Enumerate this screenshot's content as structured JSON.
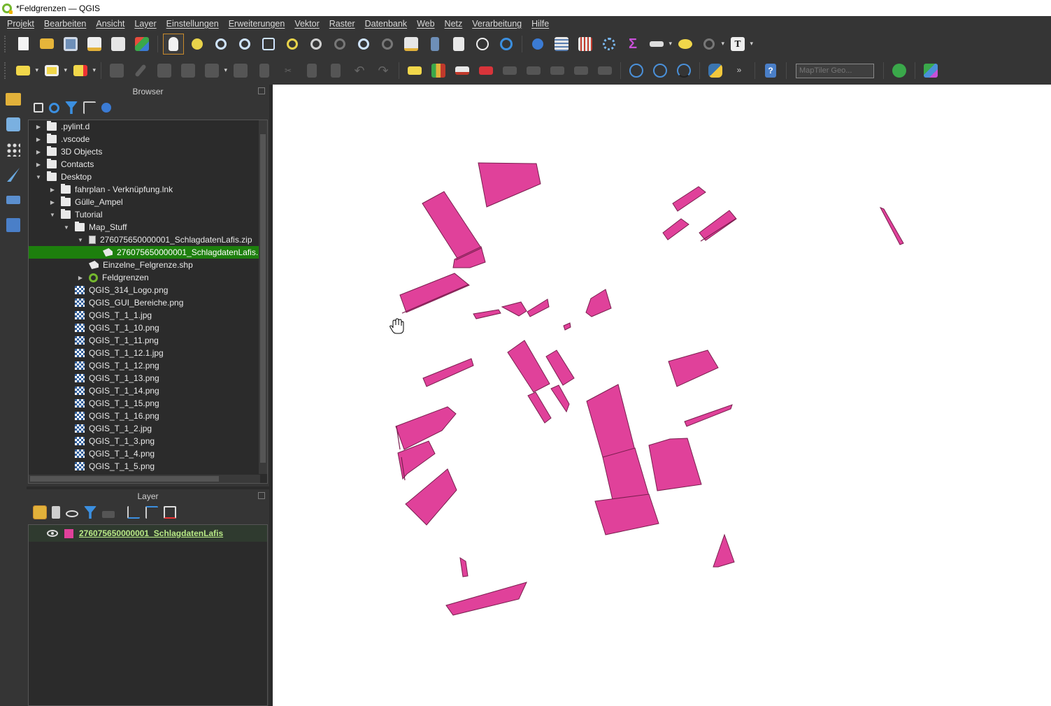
{
  "window": {
    "title": "*Feldgrenzen — QGIS"
  },
  "menubar": {
    "items": [
      "Projekt",
      "Bearbeiten",
      "Ansicht",
      "Layer",
      "Einstellungen",
      "Erweiterungen",
      "Vektor",
      "Raster",
      "Datenbank",
      "Web",
      "Netz",
      "Verarbeitung",
      "Hilfe"
    ]
  },
  "toolbar2": {
    "geocoder_placeholder": "MapTiler Geo..."
  },
  "browser": {
    "title": "Browser",
    "tree": [
      {
        "label": ".pylint.d",
        "type": "folder",
        "level": 1,
        "state": "collapsed"
      },
      {
        "label": ".vscode",
        "type": "folder",
        "level": 1,
        "state": "collapsed"
      },
      {
        "label": "3D Objects",
        "type": "folder",
        "level": 1,
        "state": "collapsed"
      },
      {
        "label": "Contacts",
        "type": "folder",
        "level": 1,
        "state": "collapsed"
      },
      {
        "label": "Desktop",
        "type": "folder",
        "level": 1,
        "state": "expanded"
      },
      {
        "label": "fahrplan - Verknüpfung.lnk",
        "type": "link",
        "level": 2,
        "state": "collapsed"
      },
      {
        "label": "Gülle_Ampel",
        "type": "folder",
        "level": 2,
        "state": "collapsed"
      },
      {
        "label": "Tutorial",
        "type": "folder",
        "level": 2,
        "state": "expanded"
      },
      {
        "label": "Map_Stuff",
        "type": "folder",
        "level": 3,
        "state": "expanded"
      },
      {
        "label": "276075650000001_SchlagdatenLafis.zip",
        "type": "zip",
        "level": 4,
        "state": "expanded"
      },
      {
        "label": "276075650000001_SchlagdatenLafis.",
        "type": "poly",
        "level": 5,
        "state": "leaf",
        "selected": true
      },
      {
        "label": "Einzelne_Felgrenze.shp",
        "type": "poly",
        "level": 4,
        "state": "leaf"
      },
      {
        "label": "Feldgrenzen",
        "type": "qgs",
        "level": 4,
        "state": "collapsed"
      },
      {
        "label": "QGIS_314_Logo.png",
        "type": "img",
        "level": 3,
        "state": "leaf"
      },
      {
        "label": "QGIS_GUI_Bereiche.png",
        "type": "img",
        "level": 3,
        "state": "leaf"
      },
      {
        "label": "QGIS_T_1_1.jpg",
        "type": "img",
        "level": 3,
        "state": "leaf"
      },
      {
        "label": "QGIS_T_1_10.png",
        "type": "img",
        "level": 3,
        "state": "leaf"
      },
      {
        "label": "QGIS_T_1_11.png",
        "type": "img",
        "level": 3,
        "state": "leaf"
      },
      {
        "label": "QGIS_T_1_12.1.jpg",
        "type": "img",
        "level": 3,
        "state": "leaf"
      },
      {
        "label": "QGIS_T_1_12.png",
        "type": "img",
        "level": 3,
        "state": "leaf"
      },
      {
        "label": "QGIS_T_1_13.png",
        "type": "img",
        "level": 3,
        "state": "leaf"
      },
      {
        "label": "QGIS_T_1_14.png",
        "type": "img",
        "level": 3,
        "state": "leaf"
      },
      {
        "label": "QGIS_T_1_15.png",
        "type": "img",
        "level": 3,
        "state": "leaf"
      },
      {
        "label": "QGIS_T_1_16.png",
        "type": "img",
        "level": 3,
        "state": "leaf"
      },
      {
        "label": "QGIS_T_1_2.jpg",
        "type": "img",
        "level": 3,
        "state": "leaf"
      },
      {
        "label": "QGIS_T_1_3.png",
        "type": "img",
        "level": 3,
        "state": "leaf"
      },
      {
        "label": "QGIS_T_1_4.png",
        "type": "img",
        "level": 3,
        "state": "leaf"
      },
      {
        "label": "QGIS_T_1_5.png",
        "type": "img",
        "level": 3,
        "state": "leaf"
      }
    ]
  },
  "layers_panel": {
    "title": "Layer",
    "layers": [
      {
        "name": "276075650000001_SchlagdatenLafis",
        "visible": true,
        "color": "#e0419a"
      }
    ]
  },
  "map": {
    "fill_color": "#e0419a",
    "stroke_color": "#7a1e4f",
    "background": "#ffffff",
    "cursor": "hand-pan-cursor"
  },
  "colors": {
    "selection": "#1d7f0d",
    "layer_name": "#b8e986",
    "panel_bg": "#353535",
    "tree_bg": "#2b2b2b"
  }
}
